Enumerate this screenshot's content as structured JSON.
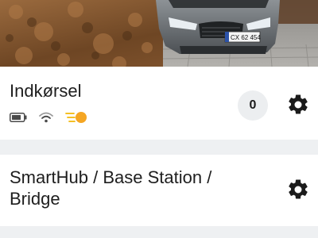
{
  "camera_card": {
    "photo": {
      "plate_text": "CX 62 454"
    },
    "title": "Indkørsel",
    "event_count": "0",
    "status_icons": [
      "battery-icon",
      "wifi-icon",
      "light-sensor-icon"
    ],
    "status_colors": {
      "battery": "#4a4a4a",
      "wifi": "#4a4a4a",
      "sensor_lines": "#f2b705",
      "sensor_dot": "#f5a623"
    }
  },
  "hub_card": {
    "title": "SmartHub / Base Station / Bridge"
  },
  "icons": {
    "settings": "gear-icon"
  },
  "colors": {
    "page_bg": "#eef0f2",
    "card_bg": "#ffffff",
    "badge_bg": "#eceef0",
    "text": "#1b1b1b"
  }
}
